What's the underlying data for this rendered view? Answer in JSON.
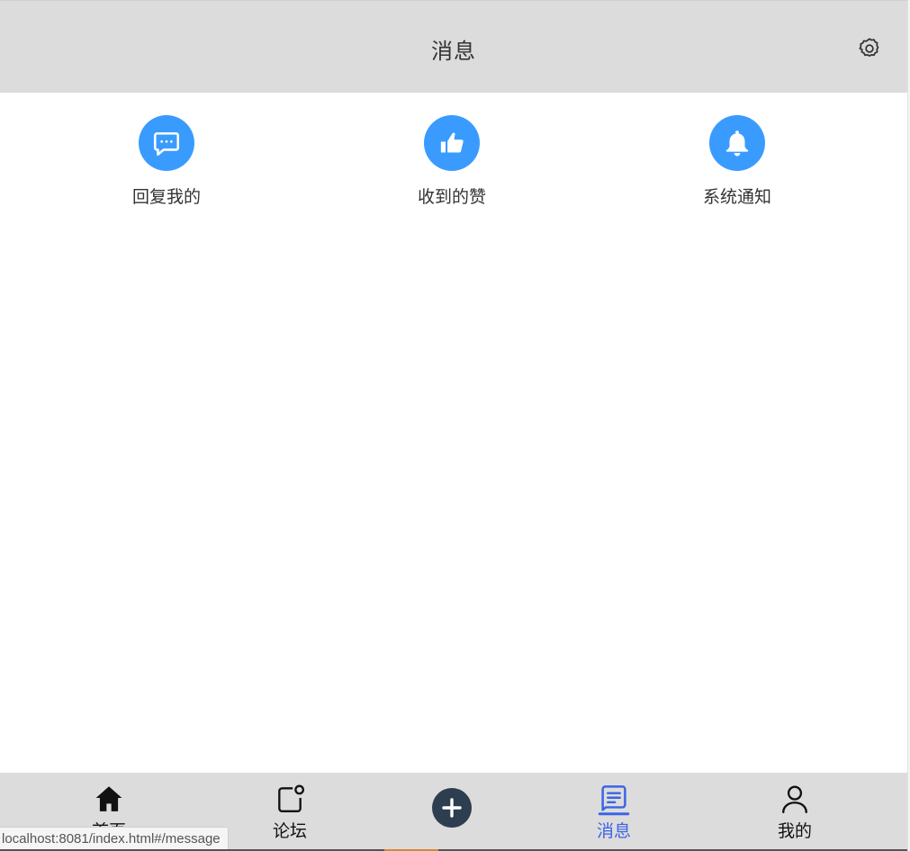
{
  "header": {
    "title": "消息",
    "settings_icon": "gear-icon"
  },
  "quick_actions": [
    {
      "label": "回复我的",
      "icon": "chat-bubble-icon"
    },
    {
      "label": "收到的赞",
      "icon": "thumbs-up-icon"
    },
    {
      "label": "系统通知",
      "icon": "bell-icon"
    }
  ],
  "tabbar": {
    "items": [
      {
        "label": "首页",
        "icon": "home-icon"
      },
      {
        "label": "论坛",
        "icon": "forum-icon"
      },
      {
        "label": "",
        "icon": "plus-icon"
      },
      {
        "label": "消息",
        "icon": "message-icon",
        "active": true
      },
      {
        "label": "我的",
        "icon": "user-icon"
      }
    ]
  },
  "status_bar": {
    "url": "localhost:8081/index.html#/message"
  },
  "colors": {
    "accent_blue": "#3a9bff",
    "active_tab": "#3b64e6",
    "header_bg": "#dcdcdc",
    "add_button": "#2d3e50"
  }
}
